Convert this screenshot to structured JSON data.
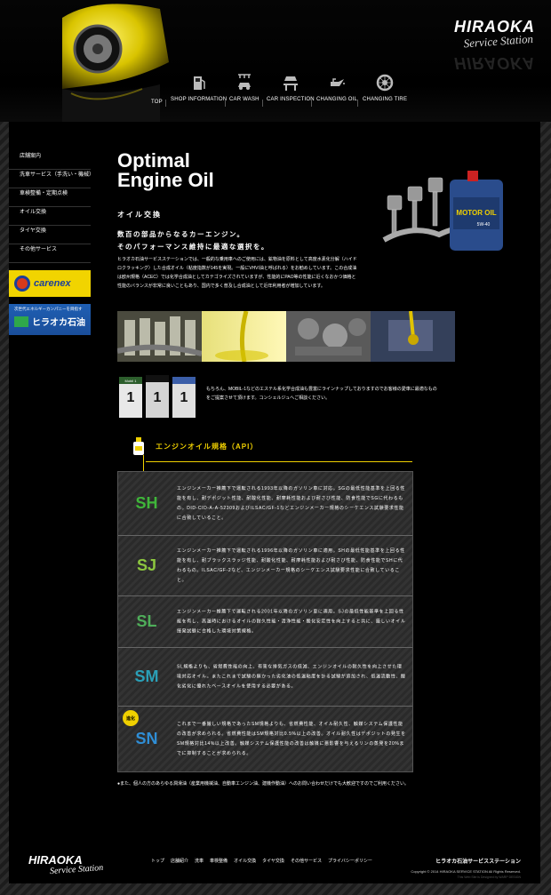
{
  "header": {
    "logo_main": "HIRAOKA",
    "logo_sub": "Service Station",
    "nav": [
      {
        "label": "TOP",
        "icon": "none"
      },
      {
        "label": "SHOP INFORMATION",
        "icon": "fuel-pump-icon"
      },
      {
        "label": "CAR WASH",
        "icon": "car-wash-icon"
      },
      {
        "label": "CAR INSPECTION",
        "icon": "car-lift-icon"
      },
      {
        "label": "CHANGING OIL",
        "icon": "oil-can-icon"
      },
      {
        "label": "CHANGING TIRE",
        "icon": "tire-icon"
      }
    ]
  },
  "sidebar": {
    "items": [
      "店舗案内",
      "洗車サービス（手洗い・機械）",
      "車検整備・定期点検",
      "オイル交換",
      "タイヤ交換",
      "その他サービス"
    ],
    "banner1": "carenex",
    "banner2_top": "次世代エネルギーカンパニーを目指す",
    "banner2_main": "ヒラオカ石油"
  },
  "content": {
    "title_line1": "Optimal",
    "title_line2": "Engine Oil",
    "section_label": "オイル交換",
    "lead_line1": "数百の部品からなるカーエンジン。",
    "lead_line2": "そのパフォーマンス維持に最適な選択を。",
    "body": "ヒラオカ石油サービスステーションでは、一般的な乗用車へのご使用には、鉱物油を原料として高度水素化分解（ハイドロクラッキング）した合成オイル（粘度指数が145を実現。一般にVHVI油と呼ばれる）をお勧めしています。この合成油は欧州規格（ACEC）では化学合成油としてカテゴライズされていますが、性能的にPAO等の性能に近くなおかつ価格と性能のバランスが非常に良いこともあり、国内で多く普及し合成油として近年利用者が増加しています。",
    "product_label": "MOTOR OIL",
    "product_sub": "5W-40",
    "mobil_text": "もちろん、MOBIL-1などのエステル系化学合成油も豊富にラインナップしておりますのでお客様の愛車に最適なものをご提案させて頂けます。コンシェルジュへご相談ください。",
    "mobil_label": "Mobil 1"
  },
  "api": {
    "title": "エンジンオイル規格（API）",
    "rows": [
      {
        "code": "SH",
        "color": "#3fb63a",
        "desc": "エンジンメーカー推薦下で運転される1993年以降のガソリン車に対応。SGの最低性能基準を上回る性能を有し、耐デポジット性能、耐酸化性能、耐摩耗性能および耐さび性能、防食性能でSGに代わるもの。DID-CID-A-A-52309およびILSAC/GF-1などエンジンメーカー規格のシーケエンス試験要求性能に合致していること。"
      },
      {
        "code": "SJ",
        "color": "#8cc63f",
        "desc": "エンジンメーカー推薦下で運転される1996年以降のガソリン車に適用。SHの最低性能基準を上回る性能を有し、耐ブラックスラッジ性能、耐酸化性能、耐摩耗性能および耐さび性能、防食性能でSHに代わるもの。ILSAC/GF-2など、エンジンメーカー規格のシーケエンス試験要求性能に合致していること。"
      },
      {
        "code": "SL",
        "color": "#4fae5a",
        "desc": "エンジンメーカー推薦下で運転される2001年以降のガソリン車に適用。SJの最低性能基準を上回る性能を有し、高温時におけるオイルの耐久性能・清浄性能・酸化安定性を向上すると共に、厳しいオイル揮発試験に合格した環境対策規格。"
      },
      {
        "code": "SM",
        "color": "#2aa0b8",
        "desc": "SL規格よりも、省燃費性能の向上、有害な排気ガスの低減、エンジンオイルの耐久性を向上させた環境対応オイル。またこれまで試験の無かった劣化油の低温粘度を計る試験が追加され、低温流動性、酸化劣化に優れたベースオイルを使用する必要がある。"
      },
      {
        "code": "SN",
        "color": "#2f8ed6",
        "badge": "進化",
        "desc": "これまで一番厳しい規格であったSM規格よりも、省燃費性能、オイル耐久性、触媒システム保護性能の改善が求められる。省燃費性能はSM規格対比0.5%以上の改善。オイル耐久性はデポジットの発生をSM規格対比14%以上改善。触媒システム保護性能の改善は触媒に悪影響を与えるリンの蒸発を20%までに抑制することが求められる。"
      }
    ],
    "note": "●また、個人の方のあらゆる潤滑油（産業用機械油、自動車エンジン油、建機作動油）へのお問い合わせだけでも大歓迎ですのでご利用ください。"
  },
  "footer": {
    "logo_main": "HIRAOKA",
    "logo_sub": "Service Station",
    "links": [
      "トップ",
      "店舗紹介",
      "洗車",
      "車検整備",
      "オイル交換",
      "タイヤ交換",
      "その他サービス",
      "プライバシーポリシー"
    ],
    "company": "ヒラオカ石油サービスステーション",
    "copyright": "Copyright © 2014 HIRAOKA SERVICE STATION All Rights Reserved.",
    "credit": "This Web Site is Designed by WARP DESIGN"
  }
}
